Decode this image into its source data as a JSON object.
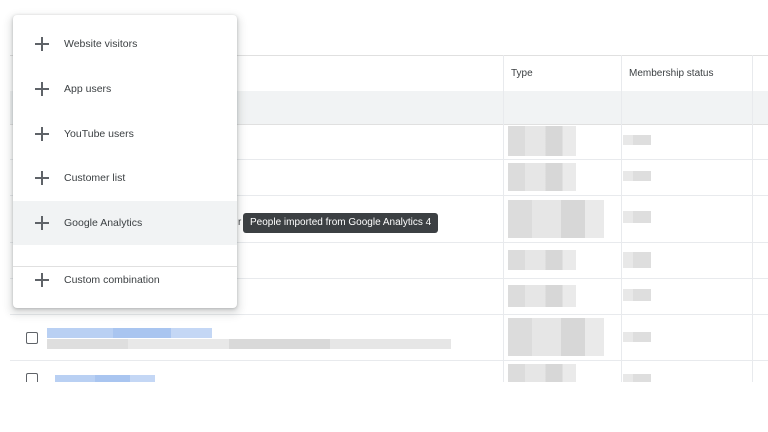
{
  "table": {
    "columns": [
      "Type",
      "Membership status"
    ]
  },
  "menu": {
    "items": [
      {
        "label": "Website visitors",
        "icon": "plus-icon"
      },
      {
        "label": "App users",
        "icon": "plus-icon"
      },
      {
        "label": "YouTube users",
        "icon": "plus-icon"
      },
      {
        "label": "Customer list",
        "icon": "plus-icon"
      },
      {
        "label": "Google Analytics",
        "icon": "plus-icon"
      },
      {
        "label": "Custom combination",
        "icon": "plus-icon"
      }
    ]
  },
  "tooltip": {
    "text": "People imported from Google Analytics 4"
  },
  "colors": {
    "tooltip_bg": "#3c4043",
    "hover_bg": "#f1f3f4",
    "icon": "#5f6368"
  }
}
